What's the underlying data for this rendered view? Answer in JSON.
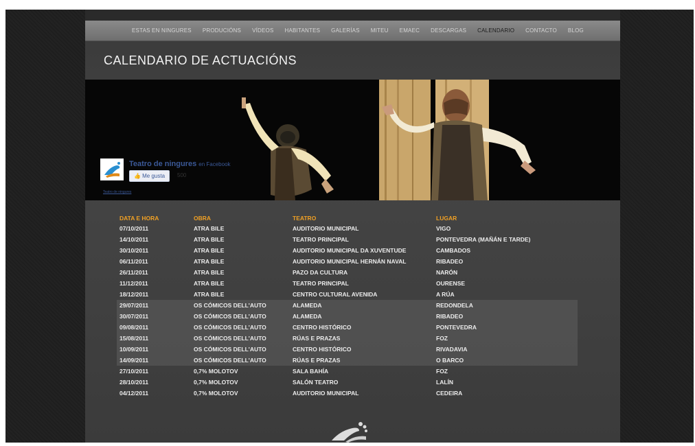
{
  "nav": {
    "items": [
      "ESTAS EN NINGURES",
      "PRODUCIÓNS",
      "VÍDEOS",
      "HABITANTES",
      "GALERÍAS",
      "MITEU",
      "EMAEC",
      "DESCARGAS",
      "CALENDARIO",
      "CONTACTO",
      "BLOG"
    ],
    "active": "CALENDARIO"
  },
  "page": {
    "title": "CALENDARIO DE ACTUACIÓNS"
  },
  "facebook": {
    "page_name": "Teatro de ningures",
    "on_label": "en Facebook",
    "like_label": "Me gusta",
    "like_count": "500",
    "footer_link": "Teatro de ningures"
  },
  "calendar": {
    "headers": [
      "DATA E HORA",
      "OBRA",
      "TEATRO",
      "LUGAR"
    ],
    "rows": [
      [
        "07/10/2011",
        "ATRA BILE",
        "AUDITORIO MUNICIPAL",
        "VIGO"
      ],
      [
        "14/10/2011",
        "ATRA BILE",
        "TEATRO PRINCIPAL",
        "PONTEVEDRA (MAÑÁN E TARDE)"
      ],
      [
        "30/10/2011",
        "ATRA BILE",
        "AUDITORIO MUNICIPAL DA XUVENTUDE",
        "CAMBADOS"
      ],
      [
        "06/11/2011",
        "ATRA BILE",
        "AUDITORIO MUNICIPAL HERNÁN NAVAL",
        "RIBADEO"
      ],
      [
        "26/11/2011",
        "ATRA BILE",
        "PAZO DA CULTURA",
        "NARÓN"
      ],
      [
        "11/12/2011",
        "ATRA BILE",
        "TEATRO PRINCIPAL",
        "OURENSE"
      ],
      [
        "18/12/2011",
        "ATRA BILE",
        "CENTRO CULTURAL AVENIDA",
        "A RÚA"
      ],
      [
        "29/07/2011",
        "OS CÓMICOS DELL'AUTO",
        "ALAMEDA",
        "REDONDELA"
      ],
      [
        "30/07/2011",
        "OS CÓMICOS DELL'AUTO",
        "ALAMEDA",
        "RIBADEO"
      ],
      [
        "09/08/2011",
        "OS CÓMICOS DELL'AUTO",
        "CENTRO HISTÓRICO",
        "PONTEVEDRA"
      ],
      [
        "15/08/2011",
        "OS CÓMICOS DELL'AUTO",
        "RÚAS E PRAZAS",
        "FOZ"
      ],
      [
        "10/09/2011",
        "OS CÓMICOS DELL'AUTO",
        "CENTRO HISTÓRICO",
        "RIVADAVIA"
      ],
      [
        "14/09/2011",
        "OS CÓMICOS DELL'AUTO",
        "RÚAS E PRAZAS",
        "O BARCO"
      ],
      [
        "27/10/2011",
        "0,7% MOLOTOV",
        "SALA BAHÍA",
        "FOZ"
      ],
      [
        "28/10/2011",
        "0,7% MOLOTOV",
        "SALÓN TEATRO",
        "LALÍN"
      ],
      [
        "04/12/2011",
        "0,7% MOLOTOV",
        "AUDITORIO MUNICIPAL",
        "CEDEIRA"
      ]
    ],
    "highlighted_rows": [
      7,
      8,
      9,
      10,
      11,
      12
    ]
  },
  "colors": {
    "accent": "#f0a024",
    "page_bg": "#3d3d3d",
    "nav_bg": "#7a7a7a",
    "facebook": "#3b5998"
  },
  "icons": {
    "footer": "footprint-logo-icon",
    "facebook_like": "thumbs-up-icon"
  }
}
